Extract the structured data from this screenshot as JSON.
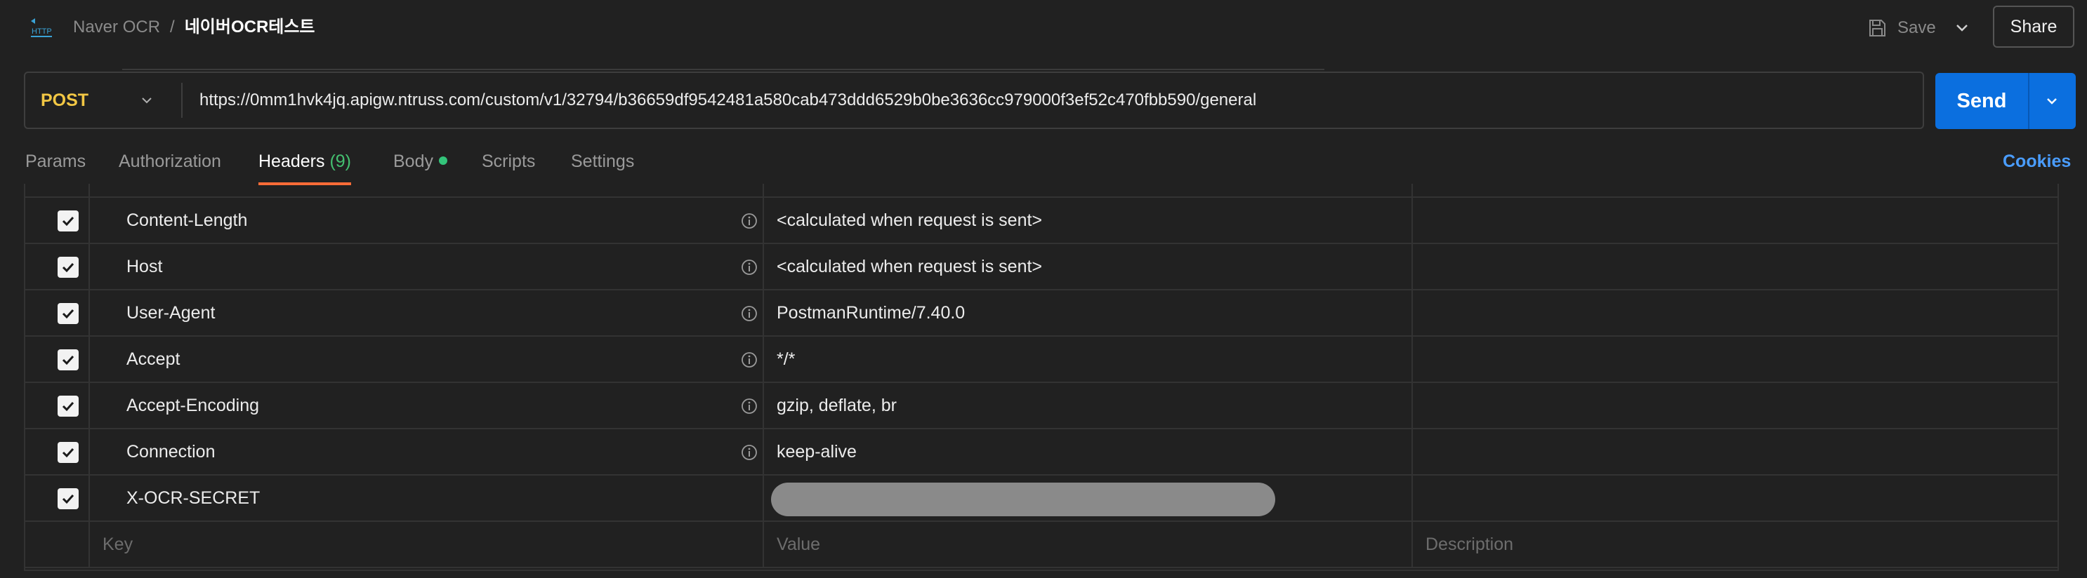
{
  "header": {
    "app_icon": "http-icon",
    "breadcrumb": {
      "parent": "Naver OCR",
      "separator": "/",
      "current": "네이버OCR테스트"
    },
    "save_label": "Save",
    "share_label": "Share"
  },
  "request": {
    "method": "POST",
    "url": "https://0mm1hvk4jq.apigw.ntruss.com/custom/v1/32794/b36659df9542481a580cab473ddd6529b0be3636cc979000f3ef52c470fbb590/general",
    "send_label": "Send"
  },
  "tabs": {
    "params": "Params",
    "authorization": "Authorization",
    "headers": "Headers",
    "headers_count": "(9)",
    "body": "Body",
    "scripts": "Scripts",
    "settings": "Settings",
    "cookies": "Cookies"
  },
  "headers_table": {
    "rows": [
      {
        "key": "Content-Length",
        "value": "<calculated when request is sent>",
        "checked": true
      },
      {
        "key": "Host",
        "value": "<calculated when request is sent>",
        "checked": true
      },
      {
        "key": "User-Agent",
        "value": "PostmanRuntime/7.40.0",
        "checked": true
      },
      {
        "key": "Accept",
        "value": "*/*",
        "checked": true
      },
      {
        "key": "Accept-Encoding",
        "value": "gzip, deflate, br",
        "checked": true
      },
      {
        "key": "Connection",
        "value": "keep-alive",
        "checked": true
      },
      {
        "key": "X-OCR-SECRET",
        "value": "",
        "checked": true
      }
    ],
    "placeholders": {
      "key": "Key",
      "value": "Value",
      "description": "Description"
    }
  },
  "colors": {
    "background": "#212121",
    "method": "#f2c744",
    "send": "#0b6fdf",
    "active_tab_underline": "#ff6c37",
    "tab_count": "#44c070",
    "cookies_link": "#4a9dff"
  }
}
